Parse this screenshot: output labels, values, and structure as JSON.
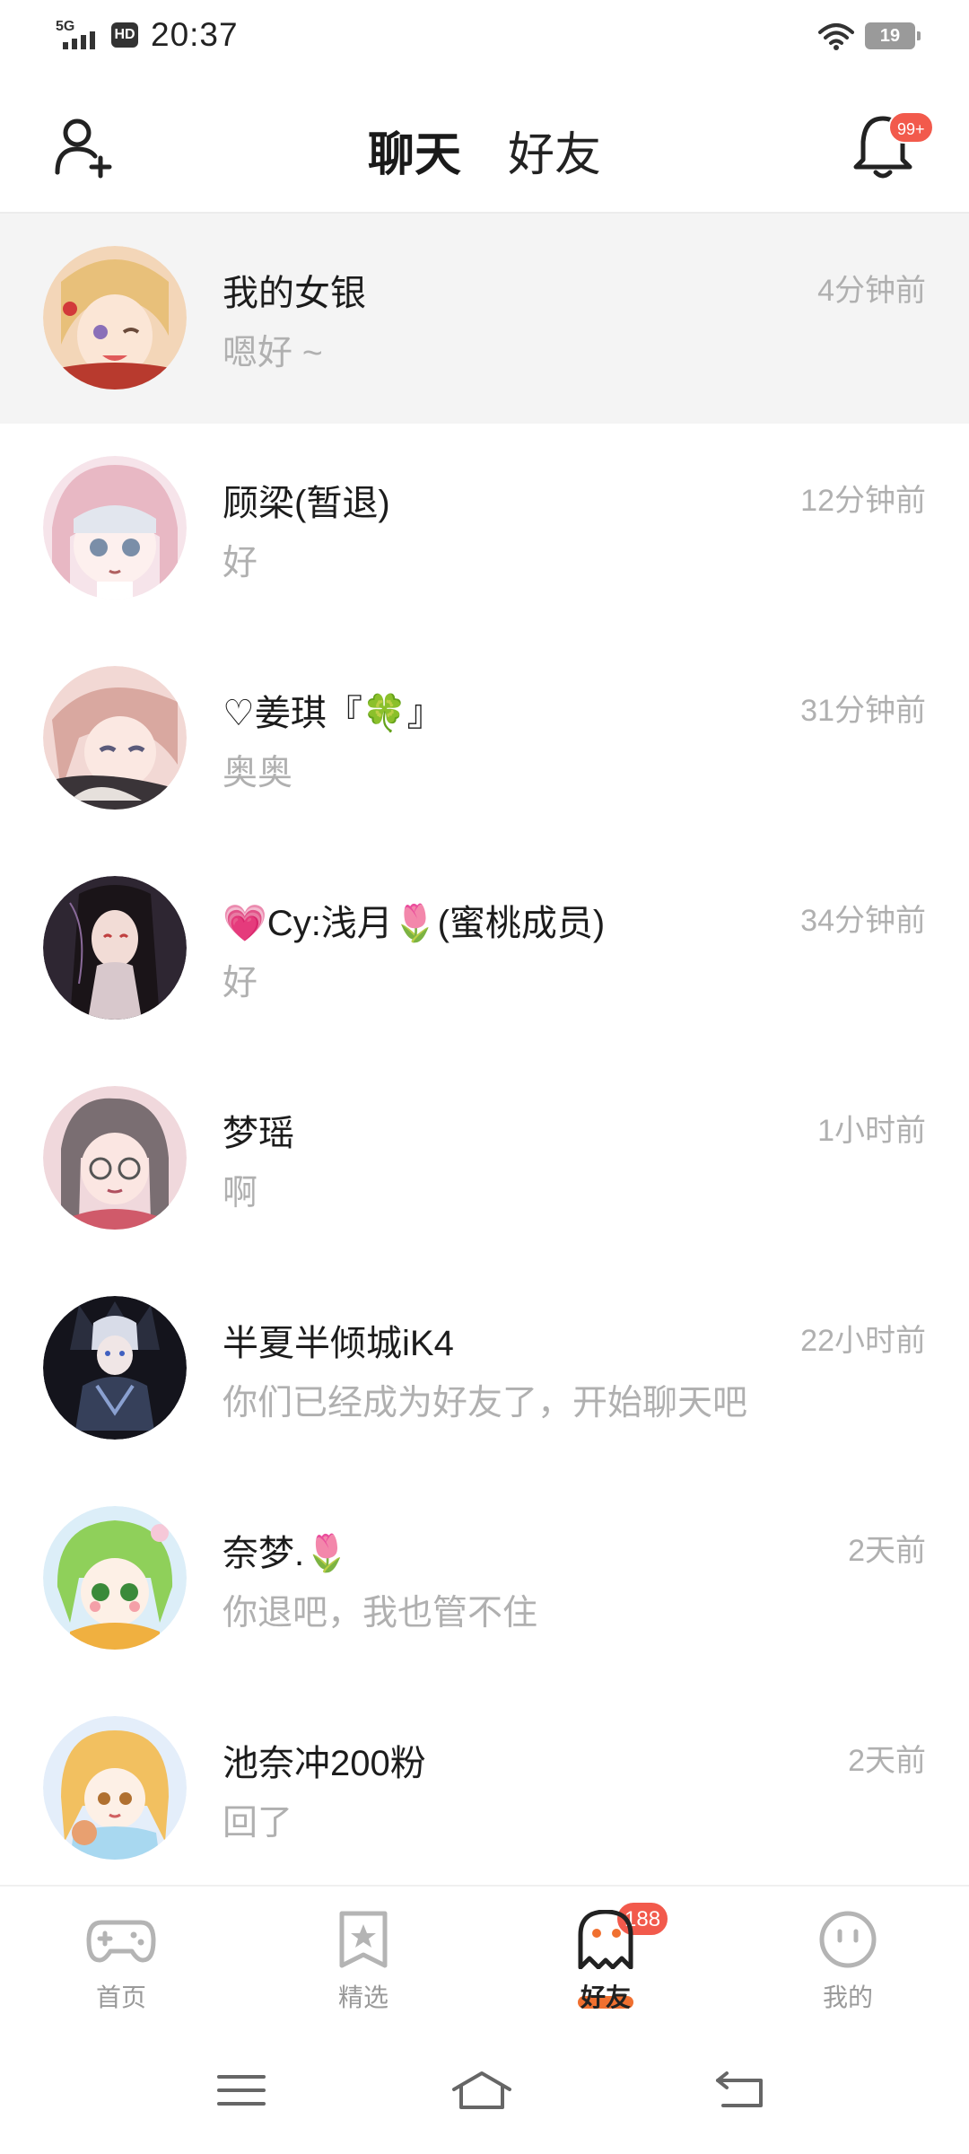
{
  "status_bar": {
    "network": "5G",
    "hd": "HD",
    "time": "20:37",
    "battery": "19",
    "icons": [
      "signal-icon",
      "hd-icon",
      "wifi-icon",
      "battery-icon"
    ]
  },
  "header": {
    "tabs": [
      {
        "label": "聊天",
        "active": true
      },
      {
        "label": "好友",
        "active": false
      }
    ],
    "notification_badge": "99+",
    "accent_color": "#f04e1f",
    "icons": {
      "left": "add-friend-icon",
      "right": "bell-icon"
    }
  },
  "chats": [
    {
      "name": "我的女银",
      "time": "4分钟前",
      "message": "嗯好 ~",
      "active": true
    },
    {
      "name": "顾梁(暂退)",
      "time": "12分钟前",
      "message": "好"
    },
    {
      "name": "♡姜琪『🍀』",
      "time": "31分钟前",
      "message": "奥奥"
    },
    {
      "name": "💗Cy:浅月🌷(蜜桃成员)",
      "time": "34分钟前",
      "message": "好"
    },
    {
      "name": "梦瑶",
      "time": "1小时前",
      "message": "啊"
    },
    {
      "name": "半夏半倾城iK4",
      "time": "22小时前",
      "message": "你们已经成为好友了，开始聊天吧"
    },
    {
      "name": "奈梦.🌷",
      "time": "2天前",
      "message": "你退吧，我也管不住"
    },
    {
      "name": "池奈冲200粉",
      "time": "2天前",
      "message": "回了"
    }
  ],
  "bottom_nav": {
    "items": [
      {
        "label": "首页",
        "icon": "gamepad-icon"
      },
      {
        "label": "精选",
        "icon": "star-bookmark-icon"
      },
      {
        "label": "好友",
        "icon": "ghost-icon",
        "active": true
      },
      {
        "label": "我的",
        "icon": "face-icon"
      }
    ],
    "friends_badge": "188"
  },
  "system_nav": {
    "icons": [
      "menu-icon",
      "home-icon",
      "back-icon"
    ]
  }
}
